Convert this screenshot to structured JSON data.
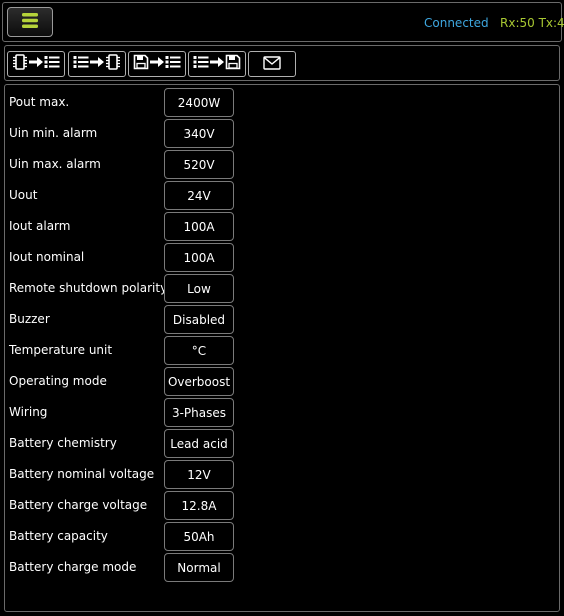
{
  "header": {
    "menu_icon": "hamburger-menu-icon",
    "connection_status": "Connected",
    "rx_tx": "Rx:50 Tx:40",
    "colors": {
      "connected": "#3ea7e0",
      "rxtx": "#a8c832",
      "menu_icon": "#b5d33a"
    }
  },
  "toolbar": {
    "buttons": [
      {
        "icons": [
          "chip-icon",
          "arrow-right-icon",
          "list-icon"
        ]
      },
      {
        "icons": [
          "list-icon",
          "arrow-right-icon",
          "chip-icon"
        ]
      },
      {
        "icons": [
          "save-icon",
          "arrow-right-icon",
          "list-icon"
        ]
      },
      {
        "icons": [
          "list-icon",
          "arrow-right-icon",
          "save-icon"
        ]
      },
      {
        "icons": [
          "envelope-icon"
        ]
      }
    ]
  },
  "settings": [
    {
      "label": "Pout max.",
      "value": "2400W"
    },
    {
      "label": "Uin min. alarm",
      "value": "340V"
    },
    {
      "label": "Uin max. alarm",
      "value": "520V"
    },
    {
      "label": "Uout",
      "value": "24V"
    },
    {
      "label": "Iout alarm",
      "value": "100A"
    },
    {
      "label": "Iout nominal",
      "value": "100A"
    },
    {
      "label": "Remote shutdown polarity",
      "value": "Low"
    },
    {
      "label": "Buzzer",
      "value": "Disabled"
    },
    {
      "label": "Temperature unit",
      "value": "°C"
    },
    {
      "label": "Operating mode",
      "value": "Overboost"
    },
    {
      "label": "Wiring",
      "value": "3-Phases"
    },
    {
      "label": "Battery chemistry",
      "value": "Lead acid"
    },
    {
      "label": "Battery nominal voltage",
      "value": "12V"
    },
    {
      "label": "Battery charge voltage",
      "value": "12.8A"
    },
    {
      "label": "Battery capacity",
      "value": "50Ah"
    },
    {
      "label": "Battery charge mode",
      "value": "Normal"
    }
  ]
}
